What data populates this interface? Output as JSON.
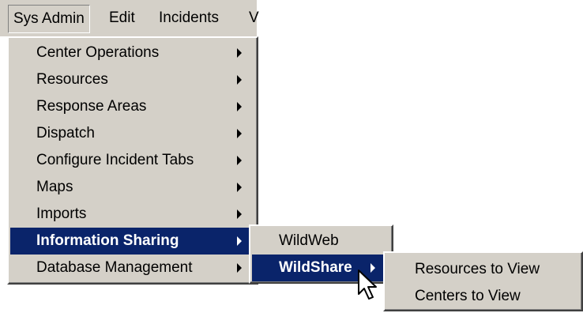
{
  "menubar": {
    "items": [
      {
        "label": "Sys Admin"
      },
      {
        "label": "Edit"
      },
      {
        "label": "Incidents"
      },
      {
        "label": "V"
      }
    ]
  },
  "sys_admin_menu": {
    "items": [
      {
        "label": "Center Operations",
        "has_submenu": true
      },
      {
        "label": "Resources",
        "has_submenu": true
      },
      {
        "label": "Response Areas",
        "has_submenu": true
      },
      {
        "label": "Dispatch",
        "has_submenu": true
      },
      {
        "label": "Configure Incident Tabs",
        "has_submenu": true
      },
      {
        "label": "Maps",
        "has_submenu": true
      },
      {
        "label": "Imports",
        "has_submenu": true
      },
      {
        "label": "Information Sharing",
        "has_submenu": true,
        "highlighted": true
      },
      {
        "label": "Database Management",
        "has_submenu": true
      }
    ]
  },
  "information_sharing_menu": {
    "items": [
      {
        "label": "WildWeb",
        "has_submenu": false
      },
      {
        "label": "WildShare",
        "has_submenu": true,
        "highlighted": true
      }
    ]
  },
  "wildshare_menu": {
    "items": [
      {
        "label": "Resources to View"
      },
      {
        "label": "Centers to View"
      }
    ]
  },
  "colors": {
    "menu_face": "#d4d0c8",
    "highlight": "#0a246a",
    "highlight_text": "#ffffff"
  },
  "cursor": {
    "icon": "arrow-pointer-icon"
  }
}
